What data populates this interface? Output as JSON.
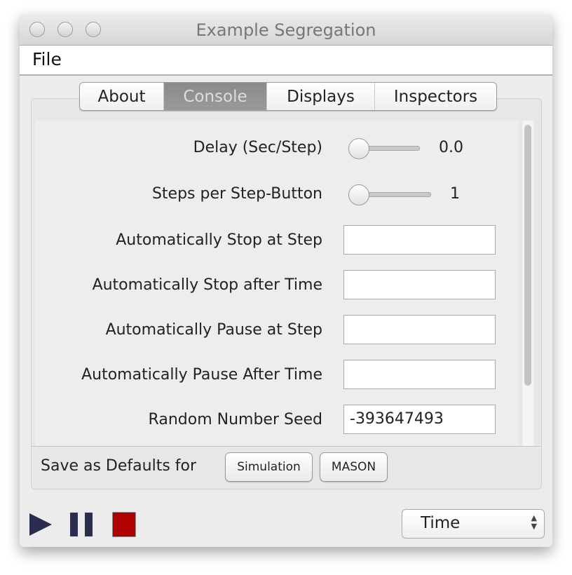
{
  "window": {
    "title": "Example Segregation"
  },
  "menu": {
    "file": "File"
  },
  "tabs": [
    {
      "label": "About"
    },
    {
      "label": "Console",
      "selected": true
    },
    {
      "label": "Displays"
    },
    {
      "label": "Inspectors"
    }
  ],
  "console": {
    "delay": {
      "label": "Delay (Sec/Step)",
      "value": "0.0"
    },
    "steps": {
      "label": "Steps per Step-Button",
      "value": "1"
    },
    "fields": [
      {
        "label": "Automatically Stop at Step",
        "value": ""
      },
      {
        "label": "Automatically Stop after Time",
        "value": ""
      },
      {
        "label": "Automatically Pause at Step",
        "value": ""
      },
      {
        "label": "Automatically Pause After Time",
        "value": ""
      },
      {
        "label": "Random Number Seed",
        "value": "-393647493"
      }
    ],
    "save_label": "Save as Defaults for",
    "simulation_button": "Simulation",
    "mason_button": "MASON"
  },
  "controls": {
    "play": "play-icon",
    "pause": "pause-icon",
    "stop": "stop-icon",
    "stop_color": "#b00000",
    "play_color": "#2b2d4e"
  },
  "time_select": {
    "value": "Time"
  }
}
